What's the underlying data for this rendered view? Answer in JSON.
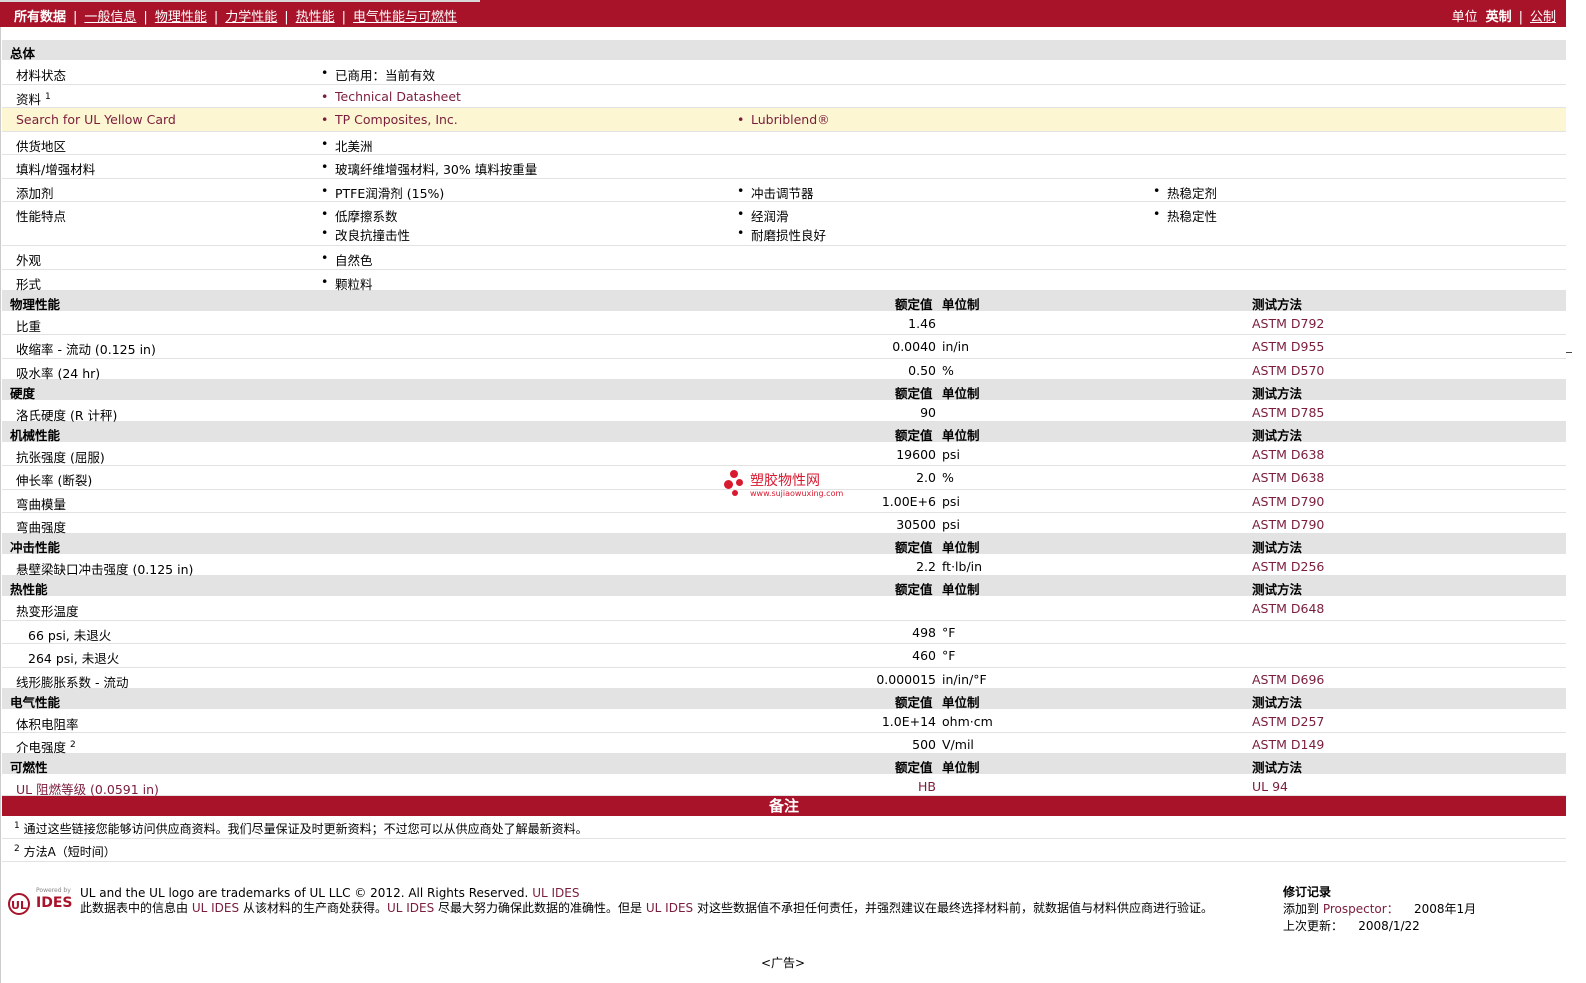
{
  "nav": {
    "tabs": [
      "所有数据",
      "一般信息",
      "物理性能",
      "力学性能",
      "热性能",
      "电气性能与可燃性"
    ],
    "units_label": "单位",
    "imperial": "英制",
    "metric": "公制"
  },
  "general": {
    "title": "总体",
    "material_status_label": "材料状态",
    "material_status": "已商用：当前有效",
    "literature_label": "资料",
    "literature_sup": "1",
    "literature_value": "Technical Datasheet",
    "ul_search_label": "Search for UL Yellow Card",
    "ul_values": [
      "TP Composites, Inc.",
      "Lubriblend®"
    ],
    "availability_label": "供货地区",
    "availability": "北美洲",
    "filler_label": "填料/增强材料",
    "filler": "玻璃纤维增强材料, 30% 填料按重量",
    "additive_label": "添加剂",
    "additives": [
      "PTFE润滑剂  (15%)",
      "冲击调节器",
      "热稳定剂"
    ],
    "features_label": "性能特点",
    "features": [
      "低摩擦系数",
      "经润滑",
      "热稳定性",
      "改良抗撞击性",
      "耐磨损性良好"
    ],
    "appearance_label": "外观",
    "appearance": "自然色",
    "form_label": "形式",
    "form": "颗粒料"
  },
  "headers": {
    "nominal": "额定值",
    "unit": "单位制",
    "method": "测试方法"
  },
  "physical": {
    "title": "物理性能",
    "rows": [
      {
        "label": "比重",
        "value": "1.46",
        "unit": "",
        "method": "ASTM D792"
      },
      {
        "label": "收缩率  - 流动  (0.125 in)",
        "value": "0.0040",
        "unit": "in/in",
        "method": "ASTM D955"
      },
      {
        "label": "吸水率  (24 hr)",
        "value": "0.50",
        "unit": "%",
        "method": "ASTM D570"
      }
    ]
  },
  "hardness": {
    "title": "硬度",
    "rows": [
      {
        "label": "洛氏硬度  (R 计秤)",
        "value": "90",
        "unit": "",
        "method": "ASTM D785"
      }
    ]
  },
  "mechanical": {
    "title": "机械性能",
    "rows": [
      {
        "label": "抗张强度  (屈服)",
        "value": "19600",
        "unit": "psi",
        "method": "ASTM D638"
      },
      {
        "label": "伸长率  (断裂)",
        "value": "2.0",
        "unit": "%",
        "method": "ASTM D638"
      },
      {
        "label": "弯曲模量",
        "value": "1.00E+6",
        "unit": "psi",
        "method": "ASTM D790"
      },
      {
        "label": "弯曲强度",
        "value": "30500",
        "unit": "psi",
        "method": "ASTM D790"
      }
    ]
  },
  "impact": {
    "title": "冲击性能",
    "rows": [
      {
        "label": "悬壁梁缺口冲击强度  (0.125 in)",
        "value": "2.2",
        "unit": "ft·lb/in",
        "method": "ASTM D256"
      }
    ]
  },
  "thermal": {
    "title": "热性能",
    "rows": [
      {
        "label": "热变形温度",
        "value": "",
        "unit": "",
        "method": "ASTM D648"
      },
      {
        "label": "66 psi, 未退火",
        "value": "498",
        "unit": "°F",
        "method": ""
      },
      {
        "label": "264 psi, 未退火",
        "value": "460",
        "unit": "°F",
        "method": ""
      },
      {
        "label": "线形膨胀系数  - 流动",
        "value": "0.000015",
        "unit": "in/in/°F",
        "method": "ASTM D696"
      }
    ]
  },
  "electrical": {
    "title": "电气性能",
    "rows": [
      {
        "label": "体积电阻率",
        "value": "1.0E+14",
        "unit": "ohm·cm",
        "method": "ASTM D257"
      },
      {
        "label": "介电强度",
        "sup": "2",
        "value": "500",
        "unit": "V/mil",
        "method": "ASTM D149"
      }
    ]
  },
  "flammability": {
    "title": "可燃性",
    "rows": [
      {
        "label": "UL 阻燃等级  (0.0591 in)",
        "value": "HB",
        "unit": "",
        "method": "UL 94"
      }
    ]
  },
  "notes": {
    "title": "备注",
    "items": [
      {
        "num": "1",
        "text": "通过这些链接您能够访问供应商资料。我们尽量保证及时更新资料；不过您可以从供应商处了解最新资料。"
      },
      {
        "num": "2",
        "text": "方法A（短时间）"
      }
    ]
  },
  "footer": {
    "logo_powered": "Powered by",
    "logo_ul": "UL",
    "logo_ides": "IDES",
    "line1": "UL and the UL logo are trademarks of UL LLC © 2012. All Rights Reserved.",
    "line1_link": "UL IDES",
    "line2_a": "此数据表中的信息由",
    "line2_link1": "UL IDES",
    "line2_b": "从该材料的生产商处获得。",
    "line2_link2": "UL IDES",
    "line2_c": "尽最大努力确保此数据的准确性。但是",
    "line2_link3": "UL IDES",
    "line2_d": "对这些数据值不承担任何责任，并强烈建议在最终选择材料前，就数据值与材料供应商进行验证。",
    "history_title": "修订记录",
    "added_label": "添加到",
    "added_link": "Prospector：",
    "added_date": "2008年1月",
    "updated_label": "上次更新：",
    "updated_date": "2008/1/22"
  },
  "watermark": {
    "name": "塑胶物性网",
    "url": "www.sujiaowuxing.com"
  },
  "ad_label": "<广告>",
  "colors": {
    "brand": "#a8132a",
    "highlight": "#fcf7d2",
    "section_bg": "#e3e3e3",
    "link": "#7a1d3c"
  }
}
